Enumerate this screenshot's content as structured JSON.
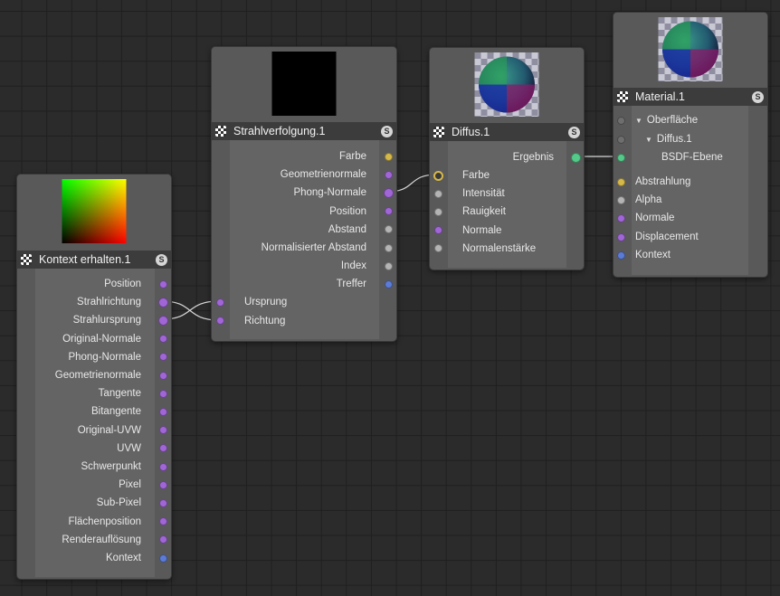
{
  "colors": {
    "canvas": "#2b2b2b",
    "node_body": "#595959",
    "node_title": "#3c3c3c",
    "port_purple": "#a066d6",
    "port_grey": "#b4b4b4",
    "port_yellow": "#d6b84a",
    "port_blue": "#5b7bd6",
    "port_green": "#54c98a",
    "port_dark": "#6e6e6e"
  },
  "nodes": {
    "kontext": {
      "title": "Kontext erhalten.1",
      "solo": "S",
      "outputs": [
        {
          "label": "Position",
          "color": "purple"
        },
        {
          "label": "Strahlrichtung",
          "color": "purple",
          "connected": true
        },
        {
          "label": "Strahlursprung",
          "color": "purple",
          "connected": true
        },
        {
          "label": "Original-Normale",
          "color": "purple"
        },
        {
          "label": "Phong-Normale",
          "color": "purple"
        },
        {
          "label": "Geometrienormale",
          "color": "purple"
        },
        {
          "label": "Tangente",
          "color": "purple"
        },
        {
          "label": "Bitangente",
          "color": "purple"
        },
        {
          "label": "Original-UVW",
          "color": "purple"
        },
        {
          "label": "UVW",
          "color": "purple"
        },
        {
          "label": "Schwerpunkt",
          "color": "purple"
        },
        {
          "label": "Pixel",
          "color": "purple"
        },
        {
          "label": "Sub-Pixel",
          "color": "purple"
        },
        {
          "label": "Flächenposition",
          "color": "purple"
        },
        {
          "label": "Renderauflösung",
          "color": "purple"
        },
        {
          "label": "Kontext",
          "color": "blue"
        }
      ]
    },
    "strahl": {
      "title": "Strahlverfolgung.1",
      "solo": "S",
      "outputs": [
        {
          "label": "Farbe",
          "color": "yellow"
        },
        {
          "label": "Geometrienormale",
          "color": "purple"
        },
        {
          "label": "Phong-Normale",
          "color": "purple",
          "connected": true
        },
        {
          "label": "Position",
          "color": "purple"
        },
        {
          "label": "Abstand",
          "color": "grey"
        },
        {
          "label": "Normalisierter Abstand",
          "color": "grey"
        },
        {
          "label": "Index",
          "color": "grey"
        },
        {
          "label": "Treffer",
          "color": "blue"
        }
      ],
      "inputs": [
        {
          "label": "Ursprung",
          "color": "purple"
        },
        {
          "label": "Richtung",
          "color": "purple"
        }
      ]
    },
    "diffus": {
      "title": "Diffus.1",
      "solo": "S",
      "outputs": [
        {
          "label": "Ergebnis",
          "color": "green",
          "connected": true
        }
      ],
      "inputs": [
        {
          "label": "Farbe",
          "color": "yellow",
          "connected": true
        },
        {
          "label": "Intensität",
          "color": "grey"
        },
        {
          "label": "Rauigkeit",
          "color": "grey"
        },
        {
          "label": "Normale",
          "color": "purple"
        },
        {
          "label": "Normalenstärke",
          "color": "grey"
        }
      ]
    },
    "material": {
      "title": "Material.1",
      "solo": "S",
      "inputs": [
        {
          "label": "Oberfläche",
          "color": "dark",
          "tree": "▼"
        },
        {
          "label": "Diffus.1",
          "color": "dark",
          "tree": "▼"
        },
        {
          "label": "BSDF-Ebene",
          "color": "green"
        },
        {
          "label": "Abstrahlung",
          "color": "yellow"
        },
        {
          "label": "Alpha",
          "color": "grey"
        },
        {
          "label": "Normale",
          "color": "purple"
        },
        {
          "label": "Displacement",
          "color": "purple"
        },
        {
          "label": "Kontext",
          "color": "blue"
        }
      ]
    }
  }
}
